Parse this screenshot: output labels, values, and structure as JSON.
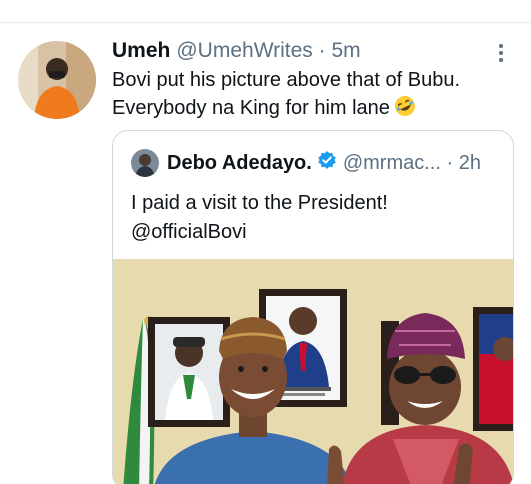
{
  "tweet": {
    "author_name": "Umeh",
    "author_handle": "@UmehWrites",
    "separator": "·",
    "time": "5m",
    "text": "Bovi put his picture above that of Bubu. Everybody na King for him lane",
    "emoji_icon": "rolling-on-floor-laughing-emoji"
  },
  "quoted_tweet": {
    "author_name": "Debo Adedayo.",
    "verified_icon": "verified-badge-icon",
    "author_handle": "@mrmac...",
    "separator": "·",
    "time": "2h",
    "text_line1": "I paid a visit to the President!",
    "text_line2": "@officialBovi"
  },
  "colors": {
    "text_primary": "#0f1419",
    "text_secondary": "#5b7083",
    "verified_blue": "#1d9bf0",
    "border": "#cfd9de"
  }
}
